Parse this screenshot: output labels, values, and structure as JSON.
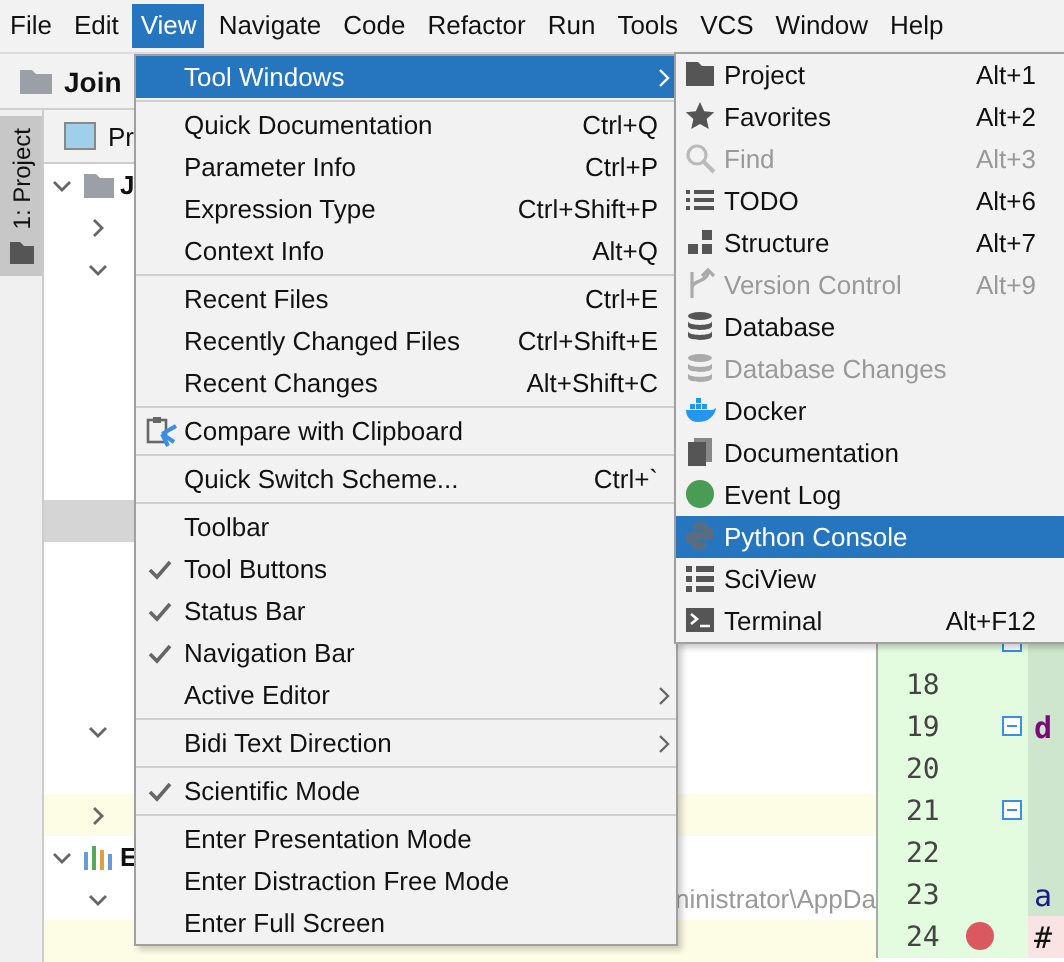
{
  "menu_bar": [
    {
      "label": "File",
      "selected": false
    },
    {
      "label": "Edit",
      "selected": false
    },
    {
      "label": "View",
      "selected": true
    },
    {
      "label": "Navigate",
      "selected": false
    },
    {
      "label": "Code",
      "selected": false
    },
    {
      "label": "Refactor",
      "selected": false
    },
    {
      "label": "Run",
      "selected": false
    },
    {
      "label": "Tools",
      "selected": false
    },
    {
      "label": "VCS",
      "selected": false
    },
    {
      "label": "Window",
      "selected": false
    },
    {
      "label": "Help",
      "selected": false
    }
  ],
  "navigation_bar": {
    "project": "Join"
  },
  "tool_strip": {
    "tab": "1: Project",
    "selected": true
  },
  "project_panel": {
    "header": "Pr",
    "rows": [
      {
        "kind": "folder",
        "expanded": true,
        "label": "J",
        "selected": false,
        "highlighted": false
      },
      {
        "kind": "child",
        "expanded": false,
        "selected": false,
        "highlighted": false
      },
      {
        "kind": "child",
        "expanded": true,
        "selected": false,
        "highlighted": false
      },
      {
        "kind": "blank",
        "selected": false,
        "highlighted": false
      },
      {
        "kind": "blank",
        "selected": false,
        "highlighted": false
      },
      {
        "kind": "blank",
        "selected": false,
        "highlighted": false
      },
      {
        "kind": "blank",
        "selected": false,
        "highlighted": false
      },
      {
        "kind": "blank",
        "selected": false,
        "highlighted": false
      },
      {
        "kind": "blank",
        "selected": true,
        "highlighted": false
      },
      {
        "kind": "blank",
        "selected": false,
        "highlighted": false
      },
      {
        "kind": "blank",
        "selected": false,
        "highlighted": false
      },
      {
        "kind": "blank",
        "selected": false,
        "highlighted": false
      },
      {
        "kind": "blank",
        "selected": false,
        "highlighted": false
      },
      {
        "kind": "child",
        "expanded": true,
        "selected": false,
        "highlighted": false
      },
      {
        "kind": "blank",
        "selected": false,
        "highlighted": false
      },
      {
        "kind": "child",
        "expanded": false,
        "selected": false,
        "highlighted": true
      },
      {
        "kind": "chart",
        "expanded": true,
        "label": "E",
        "selected": false,
        "highlighted": false
      },
      {
        "kind": "child",
        "expanded": true,
        "selected": false,
        "highlighted": false,
        "detail": "ninistrator\\AppDa"
      },
      {
        "kind": "blank",
        "selected": false,
        "highlighted": true
      }
    ]
  },
  "editor": {
    "lines": [
      {
        "fold": true,
        "breakpoint": false
      },
      {
        "number": "18",
        "fold": false,
        "breakpoint": false
      },
      {
        "number": "19",
        "fold": true,
        "breakpoint": false,
        "code": "d"
      },
      {
        "number": "20",
        "fold": false,
        "breakpoint": false
      },
      {
        "number": "21",
        "fold": true,
        "breakpoint": false
      },
      {
        "number": "22",
        "fold": false,
        "breakpoint": false
      },
      {
        "number": "23",
        "fold": false,
        "breakpoint": false,
        "code": "a"
      },
      {
        "number": "24",
        "fold": false,
        "breakpoint": true,
        "code": "#"
      }
    ]
  },
  "view_menu": {
    "items": [
      {
        "kind": "item",
        "label": "Tool Windows",
        "submenu": true,
        "selected": true,
        "checked": false
      },
      {
        "kind": "separator"
      },
      {
        "kind": "item",
        "label": "Quick Documentation",
        "shortcut": "Ctrl+Q",
        "selected": false,
        "checked": false
      },
      {
        "kind": "item",
        "label": "Parameter Info",
        "shortcut": "Ctrl+P",
        "selected": false,
        "checked": false
      },
      {
        "kind": "item",
        "label": "Expression Type",
        "shortcut": "Ctrl+Shift+P",
        "selected": false,
        "checked": false
      },
      {
        "kind": "item",
        "label": "Context Info",
        "shortcut": "Alt+Q",
        "selected": false,
        "checked": false
      },
      {
        "kind": "separator"
      },
      {
        "kind": "item",
        "label": "Recent Files",
        "shortcut": "Ctrl+E",
        "selected": false,
        "checked": false
      },
      {
        "kind": "item",
        "label": "Recently Changed Files",
        "shortcut": "Ctrl+Shift+E",
        "selected": false,
        "checked": false
      },
      {
        "kind": "item",
        "label": "Recent Changes",
        "shortcut": "Alt+Shift+C",
        "selected": false,
        "checked": false
      },
      {
        "kind": "separator"
      },
      {
        "kind": "item",
        "label": "Compare with Clipboard",
        "selected": false,
        "checked": false
      },
      {
        "kind": "separator"
      },
      {
        "kind": "item",
        "label": "Quick Switch Scheme...",
        "shortcut": "Ctrl+`",
        "selected": false,
        "checked": false
      },
      {
        "kind": "separator"
      },
      {
        "kind": "item",
        "label": "Toolbar",
        "selected": false,
        "checked": false
      },
      {
        "kind": "item",
        "label": "Tool Buttons",
        "selected": false,
        "checked": true
      },
      {
        "kind": "item",
        "label": "Status Bar",
        "selected": false,
        "checked": true
      },
      {
        "kind": "item",
        "label": "Navigation Bar",
        "selected": false,
        "checked": true
      },
      {
        "kind": "item",
        "label": "Active Editor",
        "submenu": true,
        "selected": false,
        "checked": false
      },
      {
        "kind": "separator"
      },
      {
        "kind": "item",
        "label": "Bidi Text Direction",
        "submenu": true,
        "selected": false,
        "checked": false
      },
      {
        "kind": "separator"
      },
      {
        "kind": "item",
        "label": "Scientific Mode",
        "selected": false,
        "checked": true
      },
      {
        "kind": "separator"
      },
      {
        "kind": "item",
        "label": "Enter Presentation Mode",
        "selected": false,
        "checked": false
      },
      {
        "kind": "item",
        "label": "Enter Distraction Free Mode",
        "selected": false,
        "checked": false
      },
      {
        "kind": "item",
        "label": "Enter Full Screen",
        "selected": false,
        "checked": false
      }
    ]
  },
  "tool_windows_menu": {
    "items": [
      {
        "label": "Project",
        "shortcut": "Alt+1",
        "disabled": false,
        "selected": false
      },
      {
        "label": "Favorites",
        "shortcut": "Alt+2",
        "disabled": false,
        "selected": false
      },
      {
        "label": "Find",
        "shortcut": "Alt+3",
        "disabled": true,
        "selected": false
      },
      {
        "label": "TODO",
        "shortcut": "Alt+6",
        "disabled": false,
        "selected": false
      },
      {
        "label": "Structure",
        "shortcut": "Alt+7",
        "disabled": false,
        "selected": false
      },
      {
        "label": "Version Control",
        "shortcut": "Alt+9",
        "disabled": true,
        "selected": false
      },
      {
        "label": "Database",
        "disabled": false,
        "selected": false
      },
      {
        "label": "Database Changes",
        "disabled": true,
        "selected": false
      },
      {
        "label": "Docker",
        "disabled": false,
        "selected": false
      },
      {
        "label": "Documentation",
        "disabled": false,
        "selected": false
      },
      {
        "label": "Event Log",
        "disabled": false,
        "selected": false
      },
      {
        "label": "Python Console",
        "disabled": false,
        "selected": true
      },
      {
        "label": "SciView",
        "disabled": false,
        "selected": false
      },
      {
        "label": "Terminal",
        "shortcut": "Alt+F12",
        "disabled": false,
        "selected": false
      }
    ]
  }
}
